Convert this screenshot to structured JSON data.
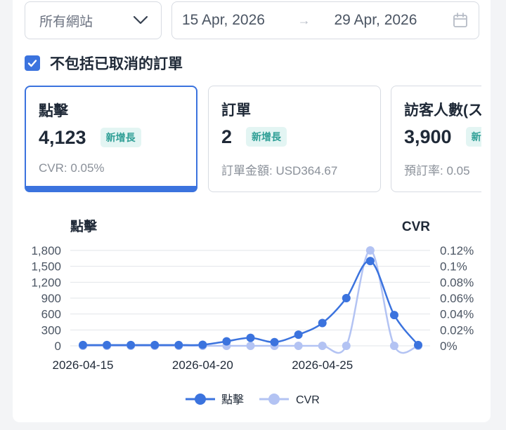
{
  "filters": {
    "site_label": "所有網站",
    "date_start": "15 Apr, 2026",
    "date_arrow": "→",
    "date_end": "29 Apr, 2026"
  },
  "exclude_cancelled": {
    "checked": true,
    "label": "不包括已取消的訂單"
  },
  "cards": [
    {
      "title": "點擊",
      "value": "4,123",
      "badge": "新增長",
      "sub": "CVR: 0.05%",
      "active": true
    },
    {
      "title": "訂單",
      "value": "2",
      "badge": "新增長",
      "sub": "訂單金額: USD364.67",
      "active": false
    },
    {
      "title": "訪客人數(ス",
      "value": "3,900",
      "badge": "新",
      "sub": "預訂率: 0.05",
      "active": false
    }
  ],
  "colors": {
    "accent": "#3b73de",
    "series_clicks": "#3b73de",
    "series_cvr": "#b3c3f3",
    "badge_text": "#2f9f96",
    "badge_bg": "#e3f5f3"
  },
  "icons": {
    "site_select": "chevron-down-icon",
    "date_range": "calendar-icon",
    "checkbox": "check-icon"
  },
  "chart_data": {
    "type": "line",
    "ylabel_left": "點擊",
    "ylabel_right": "CVR",
    "x": [
      "2026-04-15",
      "2026-04-16",
      "2026-04-17",
      "2026-04-18",
      "2026-04-19",
      "2026-04-20",
      "2026-04-21",
      "2026-04-22",
      "2026-04-23",
      "2026-04-24",
      "2026-04-25",
      "2026-04-26",
      "2026-04-27",
      "2026-04-28",
      "2026-04-29"
    ],
    "x_tick_labels": [
      "2026-04-15",
      "2026-04-20",
      "2026-04-25"
    ],
    "y_left_ticks": [
      "0",
      "300",
      "600",
      "900",
      "1,200",
      "1,500",
      "1,800"
    ],
    "y_right_ticks": [
      "0%",
      "0.02%",
      "0.04%",
      "0.06%",
      "0.08%",
      "0.1%",
      "0.12%"
    ],
    "ylim_left": [
      0,
      1800
    ],
    "ylim_right": [
      0,
      0.12
    ],
    "series": [
      {
        "name": "點擊",
        "axis": "left",
        "values": [
          15,
          15,
          15,
          15,
          15,
          20,
          85,
          150,
          70,
          210,
          430,
          900,
          1600,
          580,
          15
        ]
      },
      {
        "name": "CVR",
        "axis": "right",
        "values": [
          0,
          0,
          0,
          0,
          0,
          0,
          0,
          0,
          0,
          0,
          0,
          0,
          0.12,
          0,
          0
        ]
      }
    ],
    "legend": "bottom-center",
    "grid": true
  }
}
